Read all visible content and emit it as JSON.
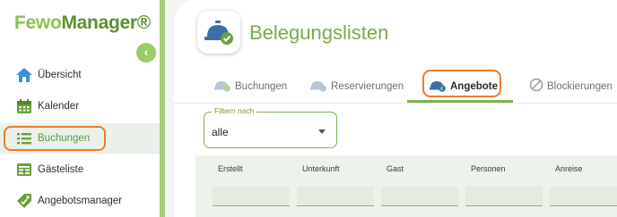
{
  "logo": {
    "part1": "Fewo",
    "part2": "Manager",
    "mark": "®"
  },
  "sidebar": {
    "collapse_icon": "chevron-left-icon",
    "items": [
      {
        "label": "Übersicht",
        "icon": "home-icon"
      },
      {
        "label": "Kalender",
        "icon": "calendar-icon"
      },
      {
        "label": "Buchungen",
        "icon": "list-icon",
        "active": true
      },
      {
        "label": "Gästeliste",
        "icon": "guest-list-icon"
      },
      {
        "label": "Angebotsmanager",
        "icon": "tag-icon"
      }
    ]
  },
  "header": {
    "title": "Belegungslisten",
    "icon": "service-bell-check-icon"
  },
  "tabs": [
    {
      "label": "Buchungen",
      "icon": "bell-check-icon"
    },
    {
      "label": "Reservierungen",
      "icon": "bell-list-icon"
    },
    {
      "label": "Angebote",
      "icon": "bell-euro-icon",
      "active": true
    },
    {
      "label": "Blockierungen",
      "icon": "block-icon"
    }
  ],
  "filter": {
    "legend": "Filtern nach",
    "value": "alle"
  },
  "table": {
    "columns": [
      "Erstellt",
      "Unterkunft",
      "Gast",
      "Personen",
      "Anreise"
    ]
  },
  "colors": {
    "accent": "#7fb24e",
    "highlight": "#f07b2b",
    "title": "#7aab4a"
  }
}
